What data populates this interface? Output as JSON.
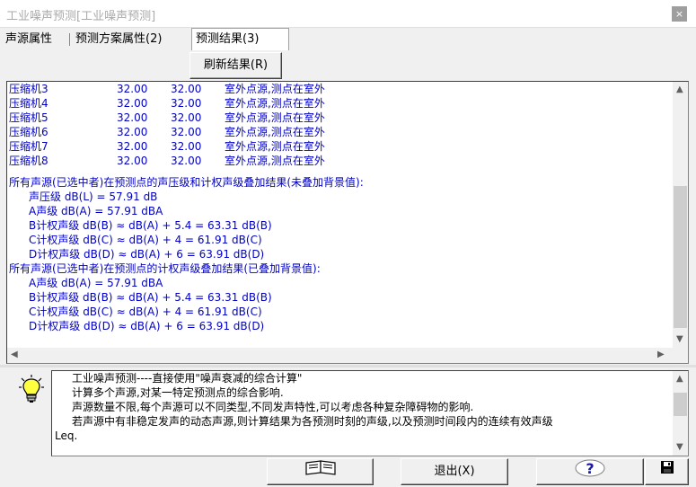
{
  "window": {
    "title": "工业噪声预测[工业噪声预测]",
    "close": "×"
  },
  "tabs": [
    {
      "label": "声源属性"
    },
    {
      "label": "预测方案属性(2)"
    },
    {
      "label": "预测结果(3)"
    }
  ],
  "refresh_label": "刷新结果(R)",
  "results": {
    "rows": [
      {
        "name": "压缩机3",
        "v1": "32.00",
        "v2": "32.00",
        "desc": "室外点源,测点在室外"
      },
      {
        "name": "压缩机4",
        "v1": "32.00",
        "v2": "32.00",
        "desc": "室外点源,测点在室外"
      },
      {
        "name": "压缩机5",
        "v1": "32.00",
        "v2": "32.00",
        "desc": "室外点源,测点在室外"
      },
      {
        "name": "压缩机6",
        "v1": "32.00",
        "v2": "32.00",
        "desc": "室外点源,测点在室外"
      },
      {
        "name": "压缩机7",
        "v1": "32.00",
        "v2": "32.00",
        "desc": "室外点源,测点在室外"
      },
      {
        "name": "压缩机8",
        "v1": "32.00",
        "v2": "32.00",
        "desc": "室外点源,测点在室外"
      }
    ],
    "summary1_header": "所有声源(已选中者)在预测点的声压级和计权声级叠加结果(未叠加背景值):",
    "summary1": [
      "声压级 dB(L) = 57.91 dB",
      "A声级  dB(A) = 57.91 dBA",
      "B计权声级 dB(B) ≈ dB(A) + 5.4 = 63.31 dB(B)",
      "C计权声级 dB(C) ≈ dB(A) +  4  = 61.91 dB(C)",
      "D计权声级 dB(D) ≈ dB(A) +  6  = 63.91 dB(D)"
    ],
    "summary2_header": "所有声源(已选中者)在预测点的计权声级叠加结果(已叠加背景值):",
    "summary2": [
      "A声级  dB(A) = 57.91 dBA",
      "B计权声级 dB(B) ≈ dB(A) + 5.4 = 63.31 dB(B)",
      "C计权声级 dB(C) ≈ dB(A) +  4  = 61.91 dB(C)",
      "D计权声级 dB(D) ≈ dB(A) +  6  = 63.91 dB(D)"
    ]
  },
  "info": {
    "lines": [
      "工业噪声预测----直接使用\"噪声衰减的综合计算\"",
      "计算多个声源,对某一特定预测点的综合影响.",
      "声源数量不限,每个声源可以不同类型,不同发声特性,可以考虑各种复杂障碍物的影响.",
      "若声源中有非稳定发声的动态声源,则计算结果为各预测时刻的声级,以及预测时间段内的连续有效声级",
      "Leq."
    ]
  },
  "buttons": {
    "exit_label": "退出(X)",
    "help_label": "?"
  },
  "icons": {
    "bulb": "lightbulb-icon",
    "book": "book-icon",
    "help": "help-icon",
    "save": "floppy-disk-icon"
  },
  "colors": {
    "result_text": "#0000c8",
    "help_blue": "#1a1aa0",
    "bulb_yellow": "#ffff40"
  }
}
